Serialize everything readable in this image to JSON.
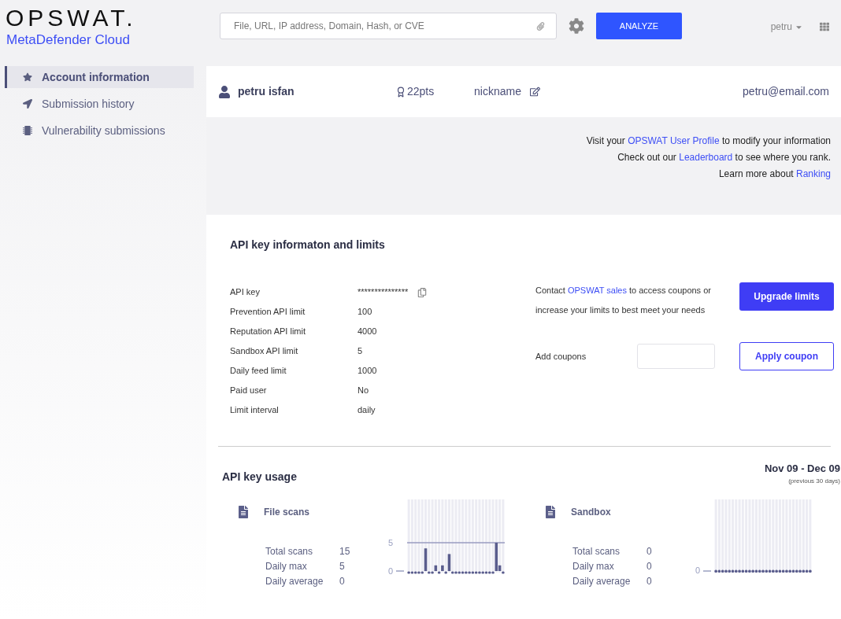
{
  "logo": {
    "wordmark": "OPSWAT.",
    "product": "MetaDefender Cloud"
  },
  "header": {
    "search": {
      "placeholder": "File, URL, IP address, Domain, Hash, or CVE"
    },
    "analyze_button": "ANALYZE",
    "user_menu": "petru"
  },
  "sidebar": {
    "items": [
      {
        "label": "Account information",
        "kind": "star",
        "selected": true
      },
      {
        "label": "Submission history",
        "kind": "arrow",
        "selected": false
      },
      {
        "label": "Vulnerability submissions",
        "kind": "chip",
        "selected": false
      }
    ]
  },
  "profile": {
    "name": "petru isfan",
    "points": "22pts",
    "nickname": "nickname",
    "email": "petru@email.com"
  },
  "info_lines": [
    {
      "parts": [
        {
          "kind": "text",
          "text": "Visit your "
        },
        {
          "kind": "link",
          "text": "OPSWAT User Profile"
        },
        {
          "kind": "text",
          "text": " to modify your information"
        }
      ]
    },
    {
      "parts": [
        {
          "kind": "text",
          "text": "Check out our "
        },
        {
          "kind": "link",
          "text": "Leaderboard"
        },
        {
          "kind": "text",
          "text": " to see where you rank."
        }
      ]
    },
    {
      "parts": [
        {
          "kind": "text",
          "text": "Learn more about "
        },
        {
          "kind": "link",
          "text": "Ranking"
        }
      ]
    }
  ],
  "api_key": {
    "title": "API key informaton and limits",
    "rows": [
      {
        "label": "API key",
        "value": "***************",
        "copy": true
      },
      {
        "label": "Prevention API limit",
        "value": "100",
        "copy": false
      },
      {
        "label": "Reputation API limit",
        "value": "4000",
        "copy": false
      },
      {
        "label": "Sandbox API limit",
        "value": "5",
        "copy": false
      },
      {
        "label": "Daily feed limit",
        "value": "1000",
        "copy": false
      },
      {
        "label": "Paid user",
        "value": "No",
        "copy": false
      },
      {
        "label": "Limit interval",
        "value": "daily",
        "copy": false
      }
    ],
    "contact": {
      "parts": [
        {
          "kind": "text",
          "text": "Contact "
        },
        {
          "kind": "link",
          "text": "OPSWAT sales"
        },
        {
          "kind": "text",
          "text": " to access coupons or increase your limits to best meet your needs"
        }
      ]
    },
    "upgrade_button": "Upgrade limits",
    "coupon_label": "Add coupons",
    "apply_button": "Apply coupon"
  },
  "usage": {
    "title": "API key usage",
    "range": "Nov 09 - Dec 09",
    "range_note": "(previous 30 days)",
    "panels": [
      {
        "title": "File scans",
        "stats": [
          {
            "label": "Total scans",
            "value": "15"
          },
          {
            "label": "Daily max",
            "value": "5"
          },
          {
            "label": "Daily average",
            "value": "0"
          }
        ],
        "chart_data": {
          "type": "bar",
          "yticks": [
            0,
            5
          ],
          "ylim": [
            0,
            5
          ],
          "values": [
            0,
            0,
            0,
            0,
            0,
            4,
            0,
            0,
            1,
            0,
            1,
            0,
            3,
            0,
            0,
            0,
            0,
            0,
            0,
            0,
            0,
            0,
            0,
            0,
            0,
            0,
            5,
            1,
            0
          ]
        }
      },
      {
        "title": "Sandbox",
        "stats": [
          {
            "label": "Total scans",
            "value": "0"
          },
          {
            "label": "Daily max",
            "value": "0"
          },
          {
            "label": "Daily average",
            "value": "0"
          }
        ],
        "baseline_label": "0"
      }
    ]
  }
}
